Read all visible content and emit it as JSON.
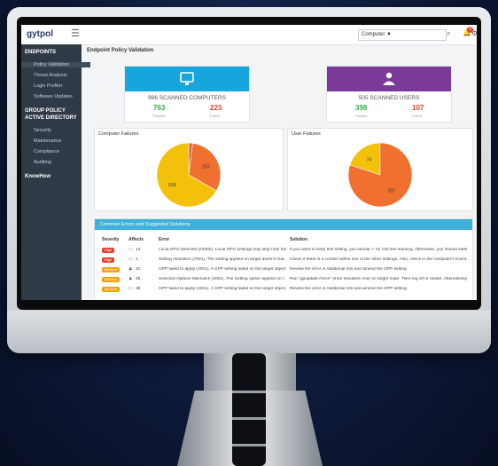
{
  "topbar": {
    "logo": "gytpol",
    "dropdown_value": "Computer ▼",
    "notif_count": "9"
  },
  "sidebar": {
    "items": [
      {
        "label": "ENDPOINTS",
        "kind": "head"
      },
      {
        "label": "Policy Validation",
        "kind": "active"
      },
      {
        "label": "Threat Analysis",
        "kind": "sub"
      },
      {
        "label": "Login Profiler",
        "kind": "sub"
      },
      {
        "label": "Software Updates",
        "kind": "sub"
      },
      {
        "label": "GROUP POLICY",
        "kind": "head"
      },
      {
        "label": "ACTIVE DIRECTORY",
        "kind": "head"
      },
      {
        "label": "Security",
        "kind": "sub"
      },
      {
        "label": "Maintenance",
        "kind": "sub"
      },
      {
        "label": "Compliance",
        "kind": "sub"
      },
      {
        "label": "Auditing",
        "kind": "sub"
      },
      {
        "label": "KnowHow",
        "kind": "head"
      }
    ]
  },
  "main": {
    "breadcrumb": "Endpoint Policy Validation",
    "computers": {
      "title": "986 SCANNED COMPUTERS",
      "passed": "763",
      "passed_label": "Passed",
      "failed": "223",
      "failed_label": "Failed",
      "color": "#17a6dc"
    },
    "users": {
      "title": "505 SCANNED USERS",
      "passed": "398",
      "passed_label": "Passed",
      "failed": "107",
      "failed_label": "Failed",
      "color": "#7a3a9a"
    },
    "computer_failures": {
      "title": "Computer Failures"
    },
    "user_failures": {
      "title": "User Failures"
    },
    "table": {
      "title": "Common Errors and Suggested Solutions",
      "headers": {
        "severity": "Severity",
        "affects": "Affects",
        "error": "Error",
        "solution": "Solution"
      }
    }
  },
  "rows": [
    {
      "severity": "High",
      "sev_color": "#e0412f",
      "affects": "13",
      "error": "Local GPO detected (#4002). Local GPO settings may stop hole from ...",
      "solution": "If you want to keep this setting, you should ✓ for Out this warning. Otherwise, you should safely L..."
    },
    {
      "severity": "High",
      "sev_color": "#e0412f",
      "affects": "1",
      "error": "Setting mismatch (7001). The setting applied on target doesn't mat...",
      "solution": "Check if there is a conflict within one of the other settings. Also, check in the computer's Event Log f..."
    },
    {
      "severity": "Medium",
      "sev_color": "#f0a30a",
      "affects": "31",
      "error": "GPP failed to apply (1001). A GPP setting failed on the target object...",
      "solution": "Review the error in Additional info and amend the GPP setting."
    },
    {
      "severity": "Medium",
      "sev_color": "#f0a30a",
      "affects": "38",
      "error": "Selected Options Mismatch (2001). The Setting option applied on t...",
      "solution": "Run \"gpupdate /force\" (from elevated cmd) on target node. Then log off or restart. Alternatively, use..."
    },
    {
      "severity": "Medium",
      "sev_color": "#f0a30a",
      "affects": "38",
      "error": "GPP failed to apply (1001). A GPP setting failed on the target object...",
      "solution": "Review the error in Additional info and amend the GPP setting."
    }
  ],
  "chart_data": [
    {
      "type": "pie",
      "title": "Computer Failures",
      "values": [
        16,
        253,
        539
      ],
      "labels": [
        "16",
        "253",
        "539"
      ],
      "colors": [
        "#e05a5a",
        "#f07030",
        "#f4c10a"
      ]
    },
    {
      "type": "pie",
      "title": "User Failures",
      "values": [
        74,
        297
      ],
      "labels": [
        "74",
        "297"
      ],
      "colors": [
        "#f4c10a",
        "#f07030"
      ]
    }
  ]
}
